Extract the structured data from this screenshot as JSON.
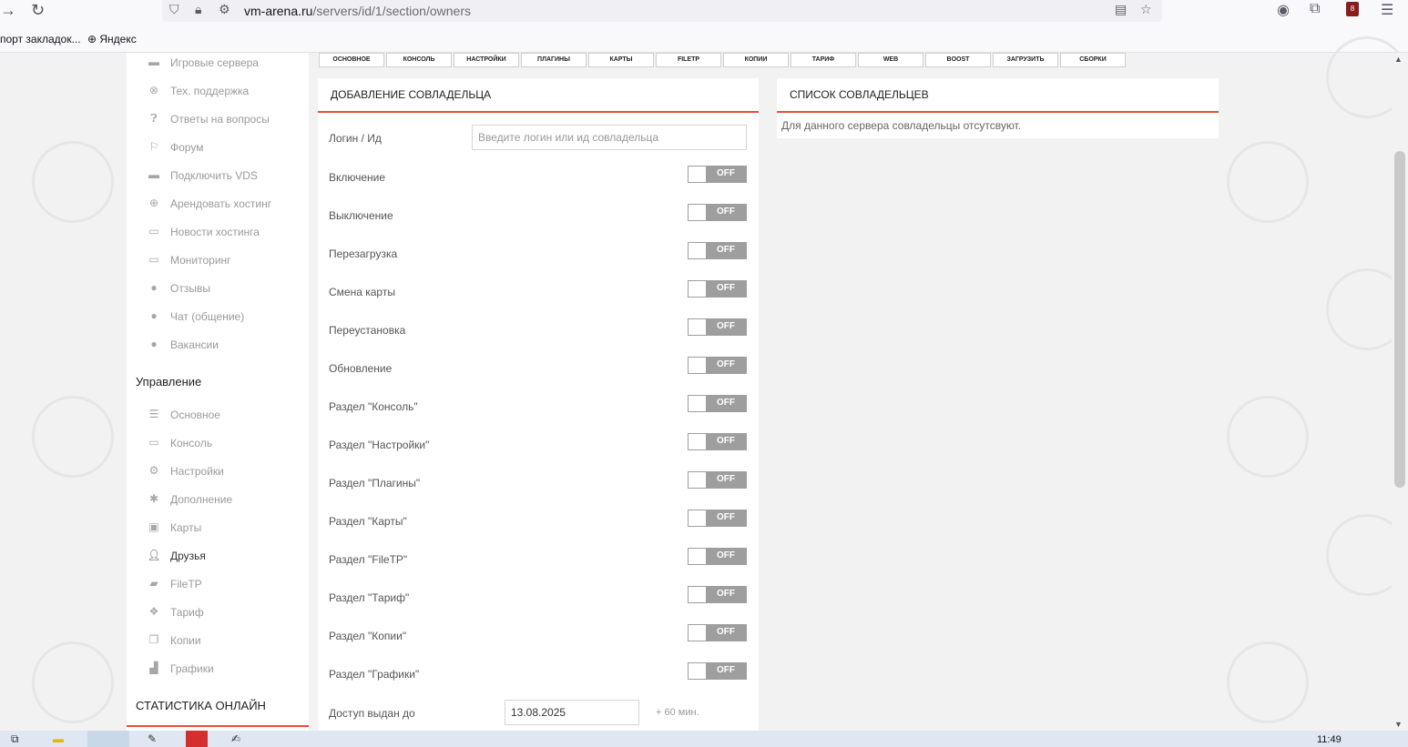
{
  "browser": {
    "url_host": "vm-arena.ru",
    "url_path": "/servers/id/1/section/owners",
    "bookmarks": [
      "порт закладок...",
      "Яндекс"
    ],
    "extension_badge": "8"
  },
  "sidebar": {
    "top_items": [
      {
        "label": "Игровые сервера",
        "icon": "gamepad-icon"
      },
      {
        "label": "Тех. поддержка",
        "icon": "lifebuoy-icon"
      },
      {
        "label": "Ответы на вопросы",
        "icon": "question-icon"
      },
      {
        "label": "Форум",
        "icon": "flag-icon"
      },
      {
        "label": "Подключить VDS",
        "icon": "gamepad-icon"
      },
      {
        "label": "Арендовать хостинг",
        "icon": "globe-icon"
      },
      {
        "label": "Новости хостинга",
        "icon": "card-icon"
      },
      {
        "label": "Мониторинг",
        "icon": "monitor-icon"
      },
      {
        "label": "Отзывы",
        "icon": "comments-icon"
      },
      {
        "label": "Чат (общение)",
        "icon": "comments-icon"
      },
      {
        "label": "Вакансии",
        "icon": "comments-icon"
      }
    ],
    "manage_heading": "Управление",
    "manage_items": [
      {
        "label": "Основное",
        "icon": "list-icon"
      },
      {
        "label": "Консоль",
        "icon": "monitor-icon"
      },
      {
        "label": "Настройки",
        "icon": "gear-icon"
      },
      {
        "label": "Дополнение",
        "icon": "puzzle-icon"
      },
      {
        "label": "Карты",
        "icon": "image-icon"
      },
      {
        "label": "Друзья",
        "icon": "user-add-icon"
      },
      {
        "label": "FileTP",
        "icon": "folder-icon"
      },
      {
        "label": "Тариф",
        "icon": "dropbox-icon"
      },
      {
        "label": "Копии",
        "icon": "copy-icon"
      },
      {
        "label": "Графики",
        "icon": "chart-icon"
      }
    ],
    "stats_heading": "СТАТИСТИКА ОНЛАЙН"
  },
  "tabs": [
    "ОСНОВНОЕ",
    "КОНСОЛЬ",
    "НАСТРОЙКИ",
    "ПЛАГИНЫ",
    "КАРТЫ",
    "FILETP",
    "КОПИИ",
    "ТАРИФ",
    "WEB",
    "BOOST",
    "ЗАГРУЗИТЬ",
    "СБОРКИ"
  ],
  "add_panel": {
    "title": "ДОБАВЛЕНИЕ СОВЛАДЕЛЬЦА",
    "login_label": "Логин / Ид",
    "login_placeholder": "Введите логин или ид совладельца",
    "permissions": [
      {
        "label": "Включение",
        "state": "OFF"
      },
      {
        "label": "Выключение",
        "state": "OFF"
      },
      {
        "label": "Перезагрузка",
        "state": "OFF"
      },
      {
        "label": "Смена карты",
        "state": "OFF"
      },
      {
        "label": "Переустановка",
        "state": "OFF"
      },
      {
        "label": "Обновление",
        "state": "OFF"
      },
      {
        "label": "Раздел \"Консоль\"",
        "state": "OFF"
      },
      {
        "label": "Раздел \"Настройки\"",
        "state": "OFF"
      },
      {
        "label": "Раздел \"Плагины\"",
        "state": "OFF"
      },
      {
        "label": "Раздел \"Карты\"",
        "state": "OFF"
      },
      {
        "label": "Раздел \"FileTP\"",
        "state": "OFF"
      },
      {
        "label": "Раздел \"Тариф\"",
        "state": "OFF"
      },
      {
        "label": "Раздел \"Копии\"",
        "state": "OFF"
      },
      {
        "label": "Раздел \"Графики\"",
        "state": "OFF"
      }
    ],
    "access_label": "Доступ выдан до",
    "access_date": "13.08.2025",
    "access_hint": "+ 60 мин."
  },
  "list_panel": {
    "title": "СПИСОК СОВЛАДЕЛЬЦЕВ",
    "empty_text": "Для данного сервера совладельцы отсутсвуют."
  },
  "taskbar": {
    "time": "11:49"
  },
  "colors": {
    "accent": "#e74c3c",
    "toggle_off": "#9e9e9e"
  }
}
